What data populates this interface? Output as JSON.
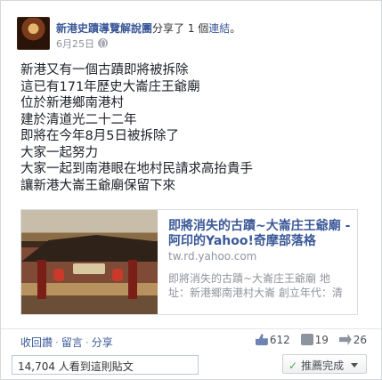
{
  "post": {
    "author": "新港史蹟導覽解說團",
    "action_text": "分享了 1 個",
    "link_word": "連結",
    "action_suffix": "。",
    "date": "6月25日",
    "privacy_icon": "globe-icon",
    "lines": [
      "新港又有一個古蹟即將被拆除",
      "這已有171年歷史大崙庄王爺廟",
      "位於新港鄉南港村",
      "建於清道光二十二年",
      "即將在今年8月5日被拆除了",
      "大家一起努力",
      "大家一起到南港眼在地村民請求高抬貴手",
      "讓新港大崙王爺廟保留下來"
    ]
  },
  "link_preview": {
    "title": "即將消失的古蹟~大崙庄王爺廟 -\n阿印的Yahoo!奇摩部落格",
    "domain": "tw.rd.yahoo.com",
    "description": "即將消失的古蹟~大崙庄王爺廟 地\n址：新港鄉南港村大崙 創立年代：清"
  },
  "actions": {
    "unlike": "收回讚",
    "comment": "留言",
    "share": "分享",
    "separator": "·"
  },
  "stats": {
    "likes": "612",
    "comments": "19",
    "shares": "26"
  },
  "footer": {
    "seen_text": "14,704 人看到這則貼文",
    "done_label": "推薦完成"
  },
  "colors": {
    "link_blue": "#3b5998",
    "meta_gray": "#90949c"
  }
}
